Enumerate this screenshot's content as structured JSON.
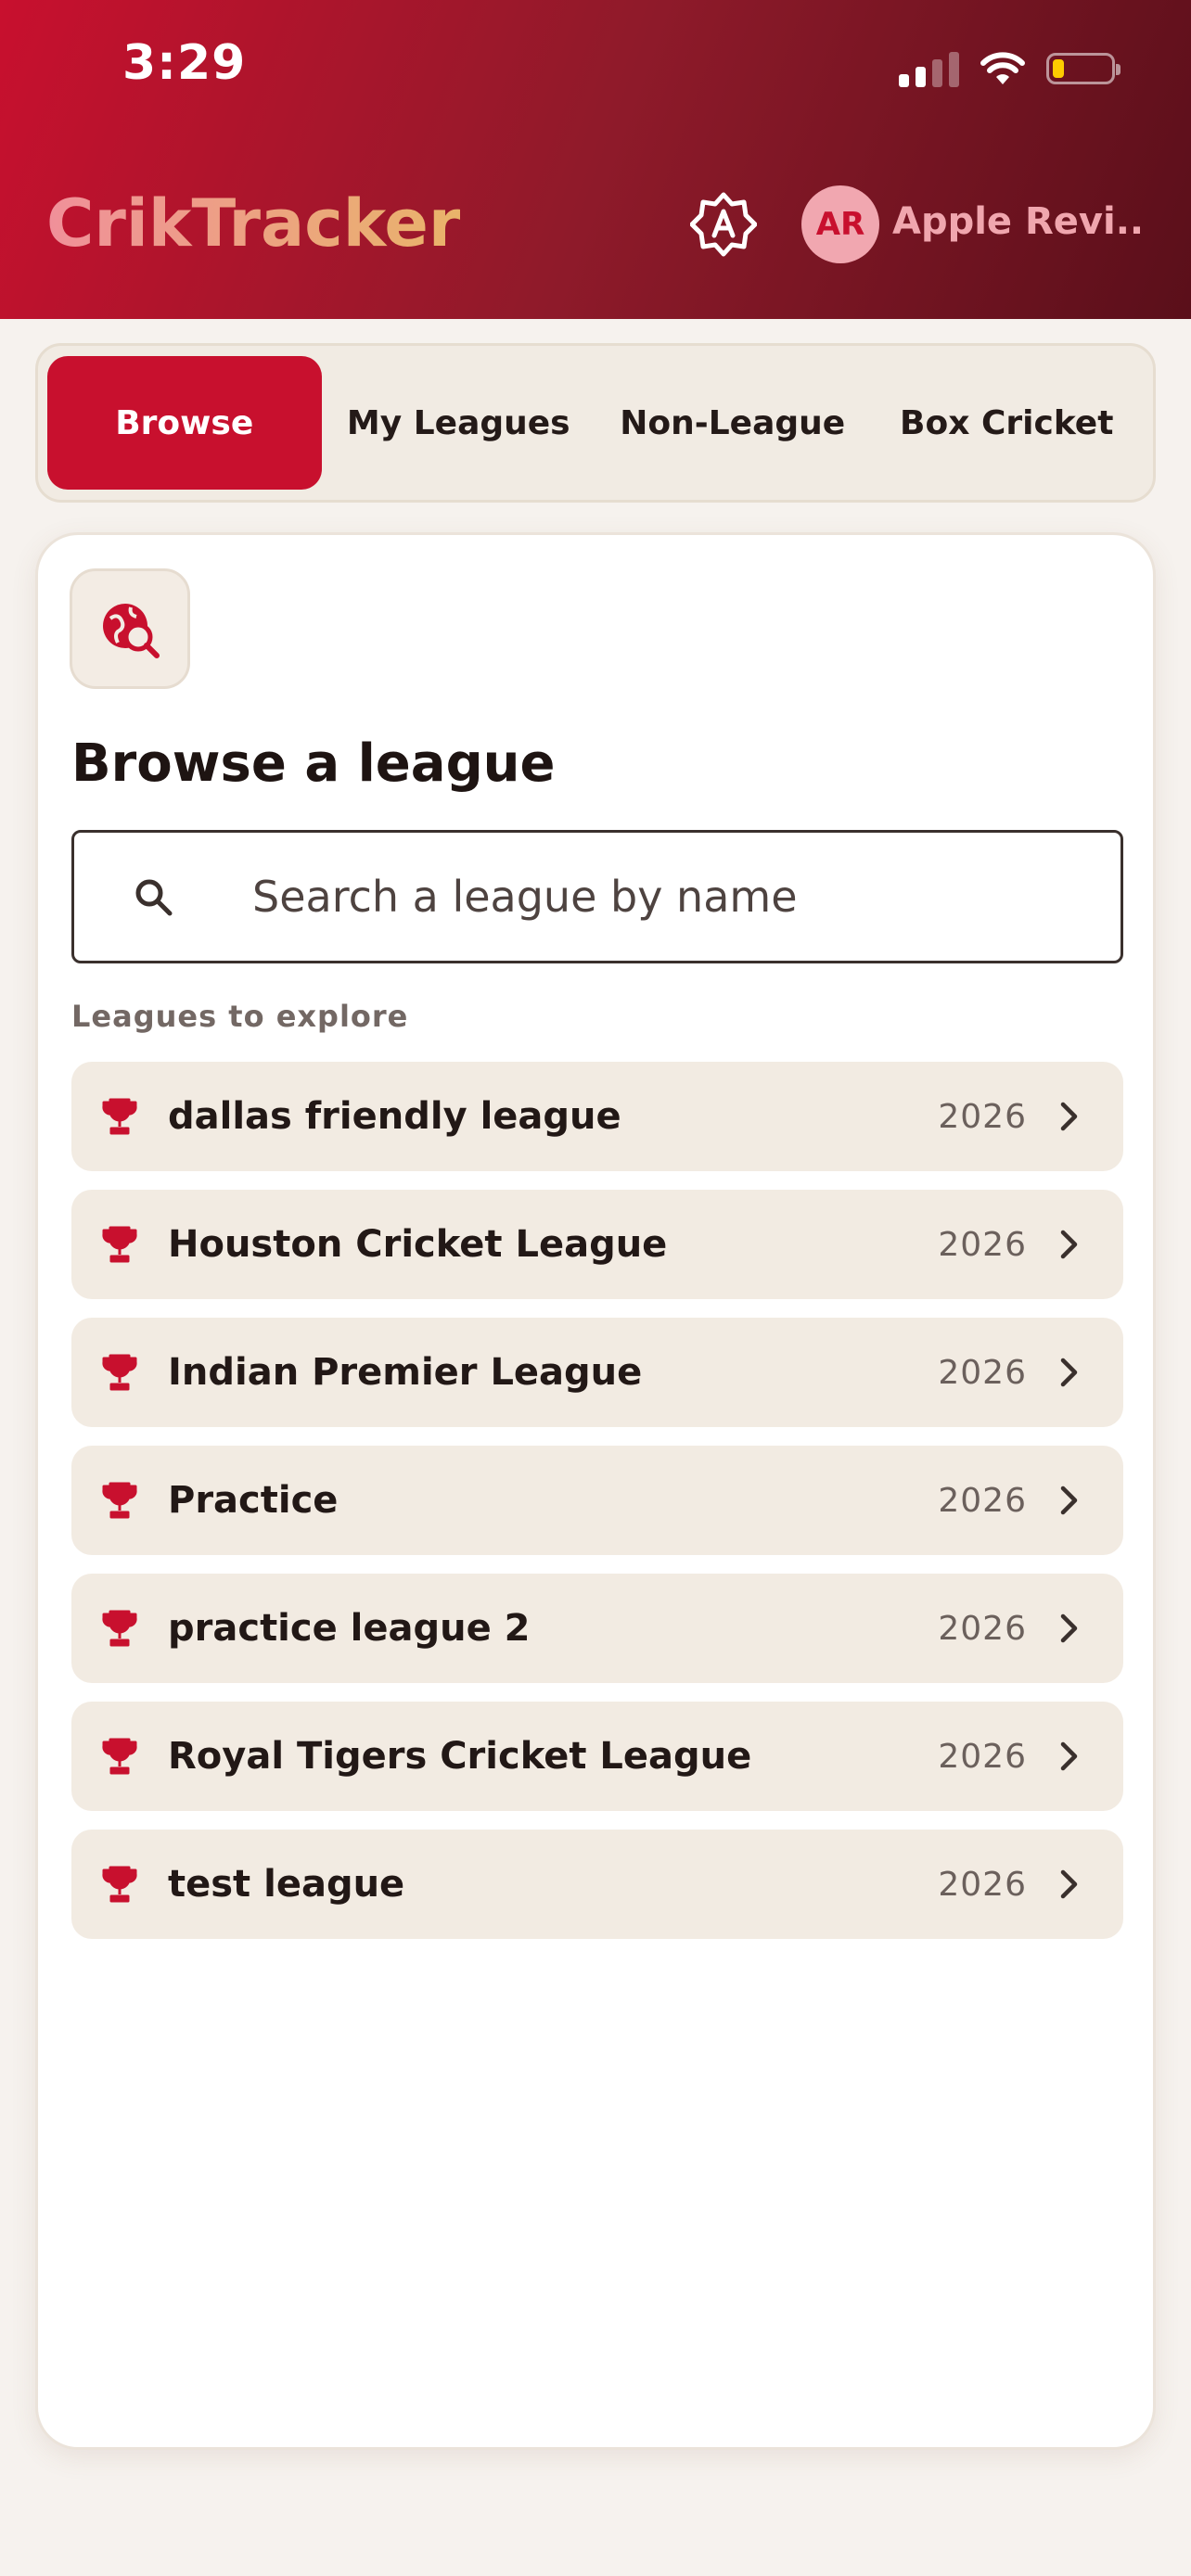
{
  "status_bar": {
    "time": "3:29"
  },
  "header": {
    "brand": "CrikTracker",
    "user_initials": "AR",
    "user_name": "Apple Revi..."
  },
  "tabs": [
    {
      "label": "Browse",
      "active": true
    },
    {
      "label": "My Leagues",
      "active": false
    },
    {
      "label": "Non-League",
      "active": false
    },
    {
      "label": "Box Cricket",
      "active": false
    }
  ],
  "browse": {
    "title": "Browse a league",
    "search_placeholder": "Search a league by name",
    "section_label": "Leagues to explore"
  },
  "leagues": [
    {
      "name": "dallas friendly league",
      "year": "2026"
    },
    {
      "name": "Houston Cricket League",
      "year": "2026"
    },
    {
      "name": "Indian Premier League",
      "year": "2026"
    },
    {
      "name": "Practice",
      "year": "2026"
    },
    {
      "name": "practice league 2",
      "year": "2026"
    },
    {
      "name": "Royal Tigers Cricket League",
      "year": "2026"
    },
    {
      "name": "test league",
      "year": "2026"
    }
  ],
  "colors": {
    "brand_red": "#c8102e",
    "header_dark": "#5a0f1a",
    "row_bg": "#f2ebe2"
  }
}
